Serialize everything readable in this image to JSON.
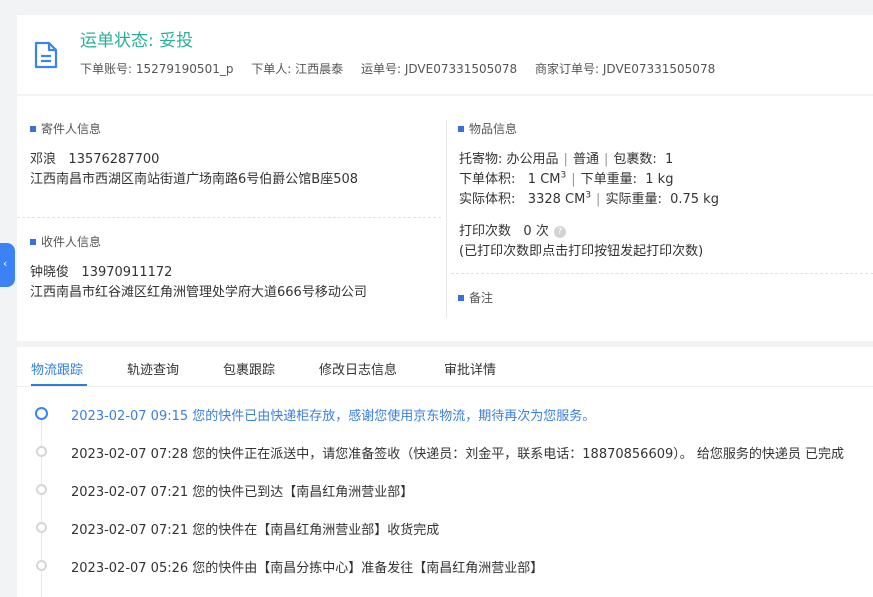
{
  "header": {
    "status_title": "运单状态: 妥投",
    "order_account": "下单账号: 15279190501_p",
    "orderer": "下单人: 江西晨泰",
    "waybill_no": "运单号: JDVE07331505078",
    "merchant_order_no": "商家订单号: JDVE07331505078"
  },
  "sender": {
    "heading": "寄件人信息",
    "name": "邓浪",
    "phone": "13576287700",
    "address": "江西南昌市西湖区南站街道广场南路6号伯爵公馆B座508"
  },
  "receiver": {
    "heading": "收件人信息",
    "name": "钟晓俊",
    "phone": "13970911172",
    "address": "江西南昌市红谷滩区红角洲管理处学府大道666号移动公司"
  },
  "goods": {
    "heading": "物品信息",
    "consigned_label": "托寄物:",
    "consigned_value": "办公用品",
    "type": "普通",
    "package_label": "包裹数:",
    "package_count": "1",
    "order_volume_label": "下单体积:",
    "order_volume_value": "1 CM",
    "order_weight_label": "下单重量:",
    "order_weight_value": "1 kg",
    "actual_volume_label": "实际体积:",
    "actual_volume_value": "3328 CM",
    "actual_weight_label": "实际重量:",
    "actual_weight_value": "0.75 kg",
    "volume_unit_sup": "3",
    "print_label": "打印次数",
    "print_count": "0 次",
    "print_note": "(已打印次数即点击打印按钮发起打印次数)",
    "help_glyph": "?"
  },
  "remark": {
    "heading": "备注"
  },
  "side_toggle": {
    "glyph": "‹"
  },
  "tabs": [
    {
      "label": "物流跟踪"
    },
    {
      "label": "轨迹查询"
    },
    {
      "label": "包裹跟踪"
    },
    {
      "label": "修改日志信息"
    },
    {
      "label": "审批详情"
    }
  ],
  "timeline": [
    {
      "text": "2023-02-07 09:15 您的快件已由快递柜存放，感谢您使用京东物流，期待再次为您服务。"
    },
    {
      "text": "2023-02-07 07:28 您的快件正在派送中，请您准备签收（快递员：刘金平，联系电话：18870856609）。 给您服务的快递员 已完成"
    },
    {
      "text": "2023-02-07 07:21 您的快件已到达【南昌红角洲营业部】"
    },
    {
      "text": "2023-02-07 07:21 您的快件在【南昌红角洲营业部】收货完成"
    },
    {
      "text": "2023-02-07 05:26 您的快件由【南昌分拣中心】准备发往【南昌红角洲营业部】"
    }
  ],
  "colors": {
    "status_green": "#2ab09a",
    "accent_blue": "#3b82f6",
    "section_marker": "#3b6fe0"
  },
  "icons": {
    "document": "document-icon",
    "help": "help-circle-icon",
    "collapse": "chevron-left-icon"
  }
}
